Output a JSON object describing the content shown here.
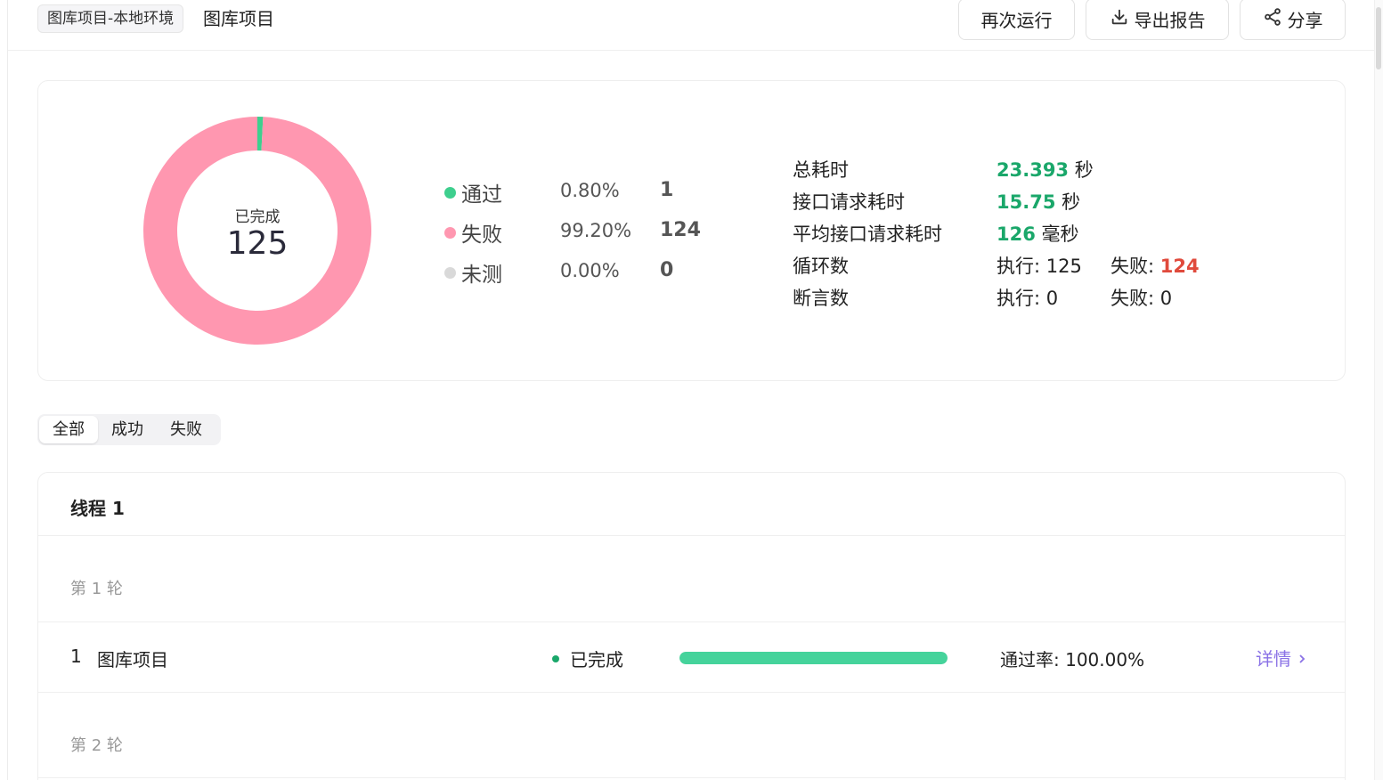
{
  "header": {
    "env_tag": "图库项目-本地环境",
    "project_name": "图库项目",
    "buttons": {
      "rerun": "再次运行",
      "export": "导出报告",
      "share": "分享"
    }
  },
  "summary": {
    "donut": {
      "label": "已完成",
      "count": "125"
    },
    "chart_data": {
      "type": "pie",
      "categories": [
        "通过",
        "失败",
        "未测"
      ],
      "values": [
        1,
        124,
        0
      ],
      "percentages": [
        "0.80%",
        "99.20%",
        "0.00%"
      ],
      "colors": [
        "#3ecf8e",
        "#ff97b0",
        "#d9d9d9"
      ]
    },
    "legend": [
      {
        "name": "通过",
        "pct": "0.80%",
        "count": "1",
        "color": "#3ecf8e"
      },
      {
        "name": "失败",
        "pct": "99.20%",
        "count": "124",
        "color": "#ff97b0"
      },
      {
        "name": "未测",
        "pct": "0.00%",
        "count": "0",
        "color": "#d9d9d9"
      }
    ],
    "metrics": {
      "total_time": {
        "label": "总耗时",
        "value": "23.393",
        "unit": "秒"
      },
      "api_time": {
        "label": "接口请求耗时",
        "value": "15.75",
        "unit": "秒"
      },
      "avg_api_time": {
        "label": "平均接口请求耗时",
        "value": "126",
        "unit": "毫秒"
      },
      "loops": {
        "label": "循环数",
        "exec_label": "执行: 125",
        "fail_label": "失败: ",
        "fail_value": "124"
      },
      "assertions": {
        "label": "断言数",
        "exec_label": "执行: 0",
        "fail_label": "失败: 0"
      }
    }
  },
  "filter_tabs": [
    "全部",
    "成功",
    "失败"
  ],
  "thread": {
    "title": "线程 1",
    "rounds": [
      {
        "label": "第 1 轮",
        "task": {
          "index": "1",
          "name": "图库项目",
          "status": "已完成",
          "status_color": "#1aa76a",
          "progress": 1.0,
          "progress_color": "#45d39b",
          "pass_rate": "通过率: 100.00%",
          "detail": "详情"
        }
      },
      {
        "label": "第 2 轮"
      }
    ]
  }
}
